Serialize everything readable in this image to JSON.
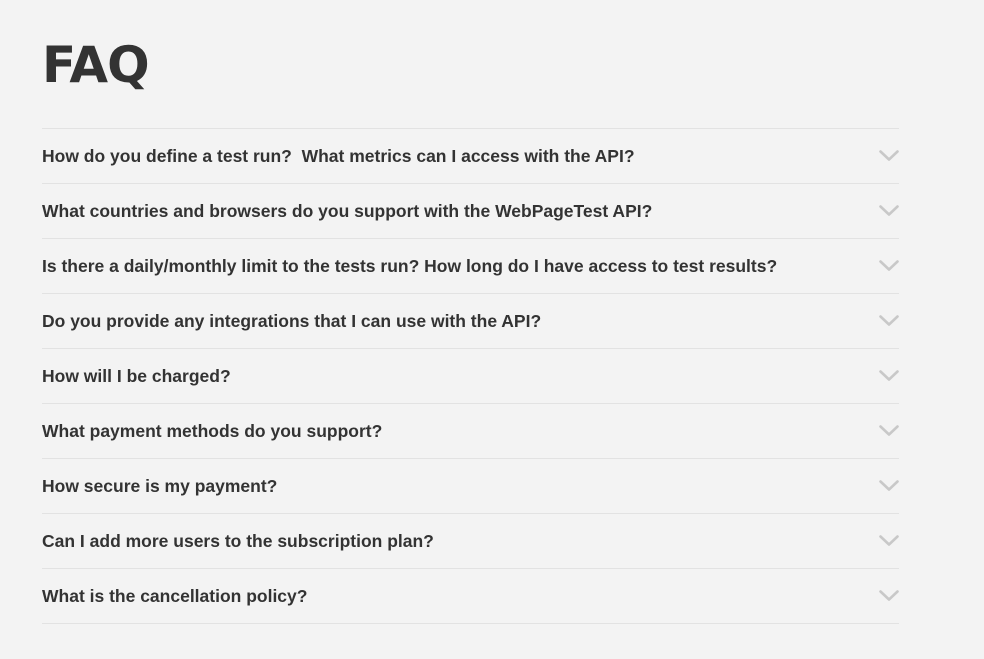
{
  "page": {
    "title": "FAQ"
  },
  "faq": {
    "items": [
      {
        "question": "How do you define a test run?  What metrics can I access with the API?",
        "expanded": false
      },
      {
        "question": "What countries and browsers do you support with the WebPageTest API?",
        "expanded": false
      },
      {
        "question": "Is there a daily/monthly limit to the tests run? How long do I have access to test results?",
        "expanded": false
      },
      {
        "question": "Do you provide any integrations that I can use with the API?",
        "expanded": false
      },
      {
        "question": "How will I be charged?",
        "expanded": false
      },
      {
        "question": "What payment methods do you support?",
        "expanded": false
      },
      {
        "question": "How secure is my payment?",
        "expanded": false
      },
      {
        "question": "Can I add more users to the subscription plan?",
        "expanded": false
      },
      {
        "question": "What is the cancellation policy?",
        "expanded": false
      }
    ],
    "icon": "chevron-down-icon"
  },
  "colors": {
    "background": "#f3f3f3",
    "text": "#333333",
    "divider": "#e2e2e2",
    "chevron": "#c8c8c8"
  }
}
